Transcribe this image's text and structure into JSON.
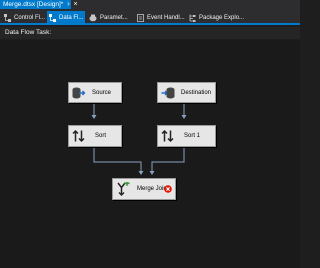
{
  "document": {
    "tab_title": "Merge.dtsx [Design]*",
    "pin_glyph": "⊦",
    "close_glyph": "×"
  },
  "designer_tabs": [
    {
      "label": "Control Fl...",
      "icon": "control-flow-icon",
      "active": false
    },
    {
      "label": "Data Fl...",
      "icon": "data-flow-icon",
      "active": true
    },
    {
      "label": "Paramet...",
      "icon": "parameters-icon",
      "active": false
    },
    {
      "label": "Event Handl...",
      "icon": "event-handlers-icon",
      "active": false
    },
    {
      "label": "Package Explo...",
      "icon": "package-explorer-icon",
      "active": false
    }
  ],
  "task": {
    "label": "Data Flow Task:"
  },
  "components": {
    "source": {
      "label": "Source",
      "icon": "ole-db-source-icon"
    },
    "destination": {
      "label": "Destination",
      "icon": "ole-db-destination-icon"
    },
    "sort": {
      "label": "Sort",
      "icon": "sort-icon"
    },
    "sort1": {
      "label": "Sort 1",
      "icon": "sort-icon"
    },
    "merge_join": {
      "label": "Merge Join",
      "icon": "merge-join-icon",
      "status": "error"
    }
  },
  "colors": {
    "accent": "#007acc",
    "connector": "#8aa0c0",
    "error": "#e51400",
    "component_bg": "#e6e6e6"
  }
}
